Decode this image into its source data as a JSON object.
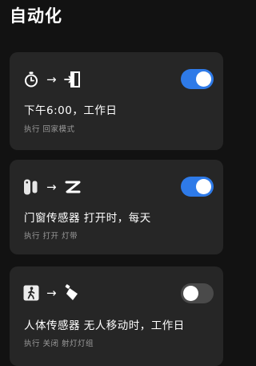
{
  "header": {
    "title": "自动化"
  },
  "automations": [
    {
      "trigger_icon": "timer-icon",
      "action_icon": "door-entry-icon",
      "arrow": "→",
      "enabled": true,
      "title": "下午6:00，工作日",
      "detail": "执行 回家模式"
    },
    {
      "trigger_icon": "door-window-sensor-icon",
      "action_icon": "light-strip-icon",
      "arrow": "→",
      "enabled": true,
      "title": "门窗传感器 打开时，每天",
      "detail": "执行 打开 灯带"
    },
    {
      "trigger_icon": "body-sensor-icon",
      "action_icon": "spotlight-icon",
      "arrow": "→",
      "enabled": false,
      "title": "人体传感器 无人移动时，工作日",
      "detail": "执行 关闭 射灯灯组"
    }
  ],
  "colors": {
    "background": "#121212",
    "card": "#262626",
    "toggle_on": "#2e7ae8",
    "toggle_off": "#4a4a4a",
    "secondary_text": "#9a9a9a"
  }
}
